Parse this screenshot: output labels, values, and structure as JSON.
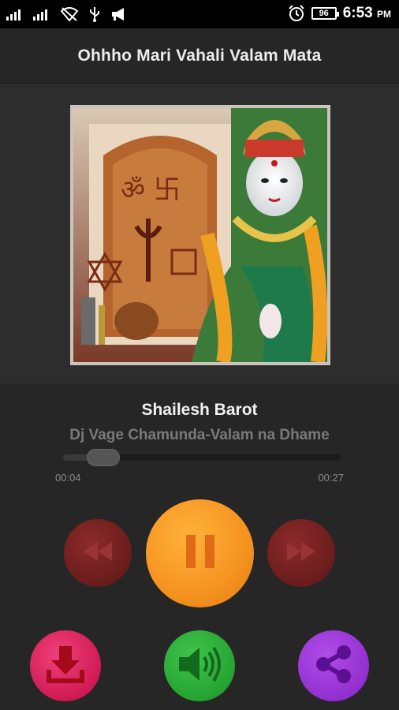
{
  "status_bar": {
    "signal1_label": "",
    "signal2_label": "",
    "battery_level": "96",
    "time": "6:53",
    "time_suffix": "PM"
  },
  "header": {
    "title": "Ohhho Mari Vahali Valam Mata"
  },
  "player": {
    "artist": "Shailesh Barot",
    "song_title": "Dj Vage Chamunda-Valam na Dhame",
    "current_time": "00:04",
    "total_time": "00:27",
    "progress_fraction": 0.148
  },
  "controls": {
    "rewind_icon": "rewind-icon",
    "pause_icon": "pause-icon",
    "forward_icon": "fast-forward-icon",
    "download_icon": "download-icon",
    "volume_icon": "volume-icon",
    "share_icon": "share-icon"
  },
  "colors": {
    "rewind_bg": "#7a2020",
    "play_bg": "#f59320",
    "download_bg": "#d01a55",
    "volume_bg": "#26a332",
    "share_bg": "#9230d0"
  }
}
